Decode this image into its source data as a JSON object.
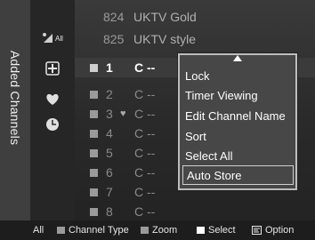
{
  "title": "Added Channels",
  "colors": {
    "accent": "#ffffff",
    "dim_text": "#8a8a8a"
  },
  "icons": [
    "all-satellite-icon",
    "add-channel-icon",
    "heart-icon",
    "clock-icon"
  ],
  "icon_labels": {
    "all": "All"
  },
  "channels": [
    {
      "number": "824",
      "name": "UKTV Gold",
      "style": "top"
    },
    {
      "number": "825",
      "name": "UKTV style",
      "style": "top"
    },
    {
      "number": "1",
      "name": "C --",
      "style": "sel"
    },
    {
      "number": "2",
      "name": "C --",
      "style": "dim"
    },
    {
      "number": "3",
      "name": "C --",
      "style": "dim",
      "fav": "♥"
    },
    {
      "number": "4",
      "name": "C --",
      "style": "dim"
    },
    {
      "number": "5",
      "name": "C --",
      "style": "dim"
    },
    {
      "number": "6",
      "name": "C --",
      "style": "dim"
    },
    {
      "number": "7",
      "name": "C --",
      "style": "dim"
    },
    {
      "number": "8",
      "name": "C --",
      "style": "dim"
    }
  ],
  "menu": {
    "items": [
      "Lock",
      "Timer Viewing",
      "Edit Channel Name",
      "Sort",
      "Select All",
      "Auto Store"
    ],
    "focused_index": 5
  },
  "footer": {
    "all": "All",
    "channel_type": "Channel Type",
    "zoom": "Zoom",
    "select": "Select",
    "option": "Option",
    "channel_type_color": "#9a9a9a",
    "zoom_color": "#9a9a9a",
    "select_color": "#ffffff"
  }
}
